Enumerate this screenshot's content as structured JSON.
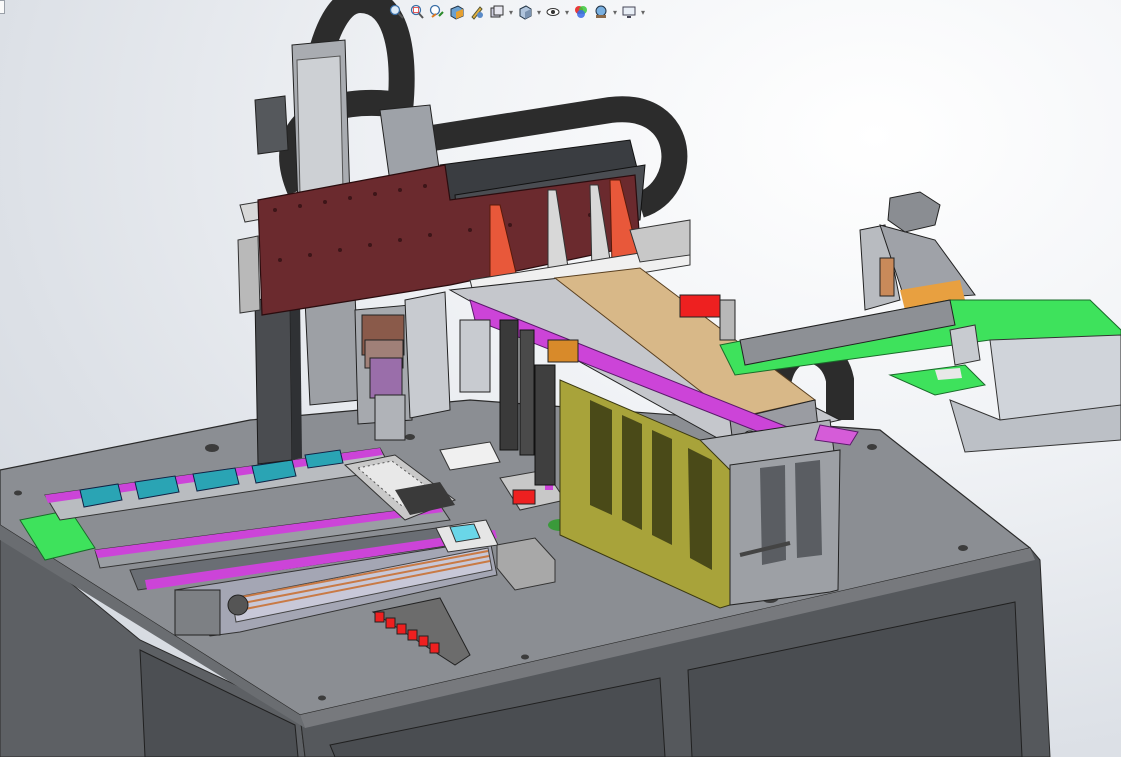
{
  "app": {
    "name": "CAD 3D Viewport",
    "view_mode": "shaded-with-edges"
  },
  "heads_up_toolbar": [
    {
      "id": "zoom-to-fit",
      "icon": "zoom-to-fit-icon",
      "dropdown": false
    },
    {
      "id": "zoom-to-area",
      "icon": "zoom-to-area-icon",
      "dropdown": false
    },
    {
      "id": "previous-view",
      "icon": "previous-view-icon",
      "dropdown": false
    },
    {
      "id": "section-view",
      "icon": "section-view-icon",
      "dropdown": false
    },
    {
      "id": "dynamic-annotation",
      "icon": "dynamic-annotation-icon",
      "dropdown": false
    },
    {
      "id": "view-orientation",
      "icon": "view-orientation-icon",
      "dropdown": true
    },
    {
      "id": "display-style",
      "icon": "display-style-icon",
      "dropdown": true
    },
    {
      "id": "hide-show-items",
      "icon": "hide-show-items-icon",
      "dropdown": true
    },
    {
      "id": "edit-appearance",
      "icon": "edit-appearance-icon",
      "dropdown": false
    },
    {
      "id": "apply-scene",
      "icon": "apply-scene-icon",
      "dropdown": true
    },
    {
      "id": "view-settings",
      "icon": "view-settings-icon",
      "dropdown": true
    }
  ],
  "colors": {
    "frame_gray": "#6e7175",
    "table_top": "#8d9095",
    "maroon_plate": "#6b2a2e",
    "yellow_bracket": "#a8a33a",
    "tan_cover": "#d8b888",
    "green_plate": "#39e65a",
    "magenta_rail": "#c43fd3",
    "teal_fixture": "#2aa4b4",
    "cable_chain": "#3a3a3a",
    "orange_gusset": "#e8583a",
    "red_marker": "#ee2020"
  }
}
